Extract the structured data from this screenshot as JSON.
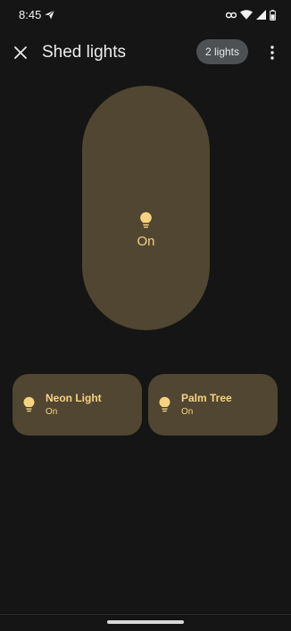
{
  "status_bar": {
    "time": "8:45",
    "icons": [
      "send-icon",
      "link-icon",
      "wifi-icon",
      "signal-icon",
      "battery-icon"
    ]
  },
  "app_bar": {
    "close_icon": "close-icon",
    "title": "Shed lights",
    "lights_chip": "2 lights",
    "more_icon": "more-vert-icon"
  },
  "main_control": {
    "icon": "lightbulb-icon",
    "state": "On"
  },
  "tiles": [
    {
      "name": "Neon Light",
      "state": "On",
      "icon": "lightbulb-icon"
    },
    {
      "name": "Palm Tree",
      "state": "On",
      "icon": "lightbulb-icon"
    }
  ],
  "colors": {
    "background": "#151515",
    "tile_on": "#504631",
    "accent_on": "#f7d283",
    "chip": "#4d5154"
  }
}
